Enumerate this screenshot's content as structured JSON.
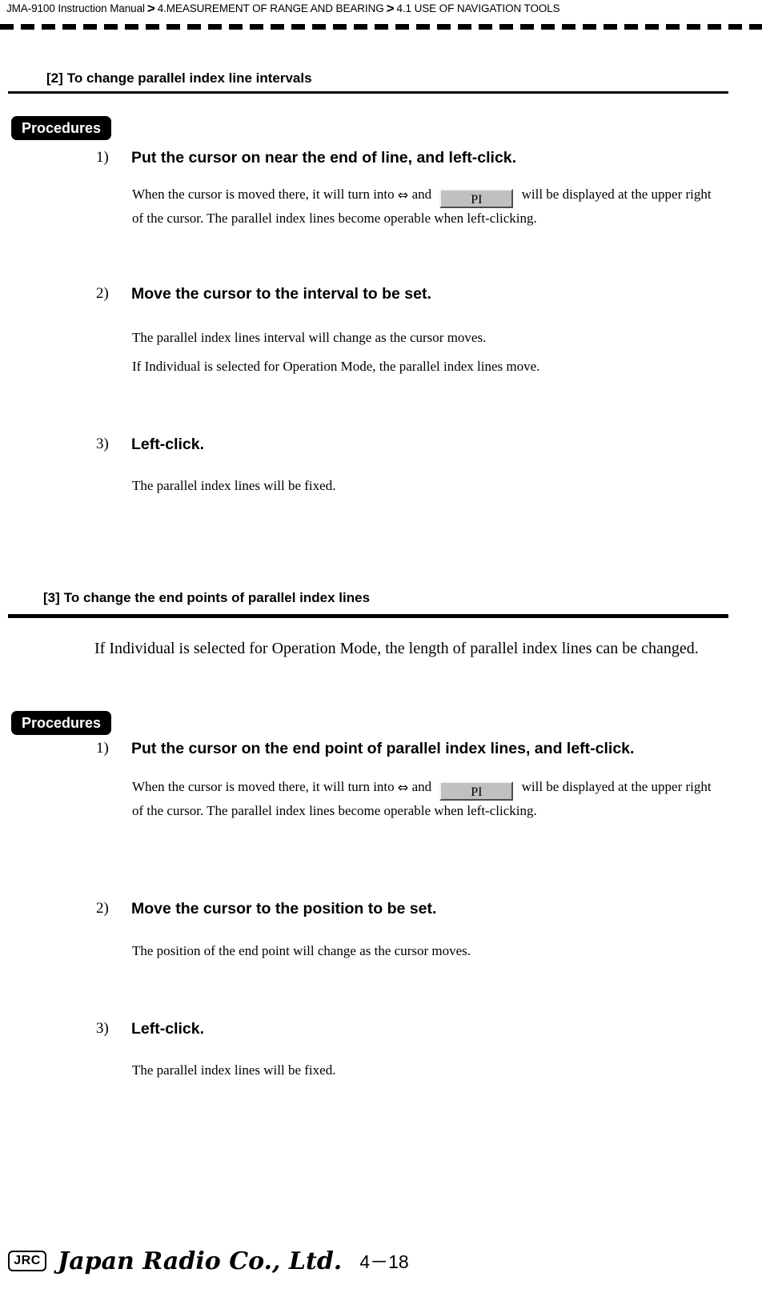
{
  "header": {
    "breadcrumb": [
      "JMA-9100 Instruction Manual",
      "4.MEASUREMENT OF RANGE AND BEARING",
      "4.1  USE OF NAVIGATION TOOLS"
    ],
    "separator": ">"
  },
  "sections": [
    {
      "number": "[2]",
      "title": "To change parallel index line intervals",
      "procedures_label": "Procedures",
      "steps": [
        {
          "number": "1)",
          "title": "Put the cursor on near the end of line, and left-click.",
          "body_prefix": "When the cursor is moved there, it will turn into",
          "arrow": "⇔",
          "body_mid": "and",
          "button_label": "PI",
          "body_suffix": "will be displayed at the upper right of the cursor. The parallel index lines become operable when left-clicking."
        },
        {
          "number": "2)",
          "title": "Move the cursor to the interval to be set.",
          "body_lines": [
            "The parallel index lines interval will change as the cursor moves.",
            "If Individual is selected for Operation Mode, the parallel index lines move."
          ]
        },
        {
          "number": "3)",
          "title": "Left-click.",
          "body_lines": [
            "The parallel index lines will be fixed."
          ]
        }
      ]
    },
    {
      "number": "[3]",
      "title": "To change the end points of parallel index lines",
      "intro": "If Individual is selected for Operation Mode, the length of parallel index lines can be changed.",
      "procedures_label": "Procedures",
      "steps": [
        {
          "number": "1)",
          "title": "Put the cursor on the end point of parallel index lines, and left-click.",
          "body_prefix": "When the cursor is moved there, it will turn into",
          "arrow": "⇔",
          "body_mid": "and",
          "button_label": "PI",
          "body_suffix": "will be displayed at the upper right of the cursor. The parallel index lines become operable when left-clicking."
        },
        {
          "number": "2)",
          "title": "Move the cursor to the position to be set.",
          "body_lines": [
            "The position of the end point will change as the cursor moves."
          ]
        },
        {
          "number": "3)",
          "title": "Left-click.",
          "body_lines": [
            "The parallel index lines will be fixed."
          ]
        }
      ]
    }
  ],
  "footer": {
    "logo_mark": "JRC",
    "company": "Japan Radio Co., Ltd.",
    "page_number": "4－18"
  }
}
